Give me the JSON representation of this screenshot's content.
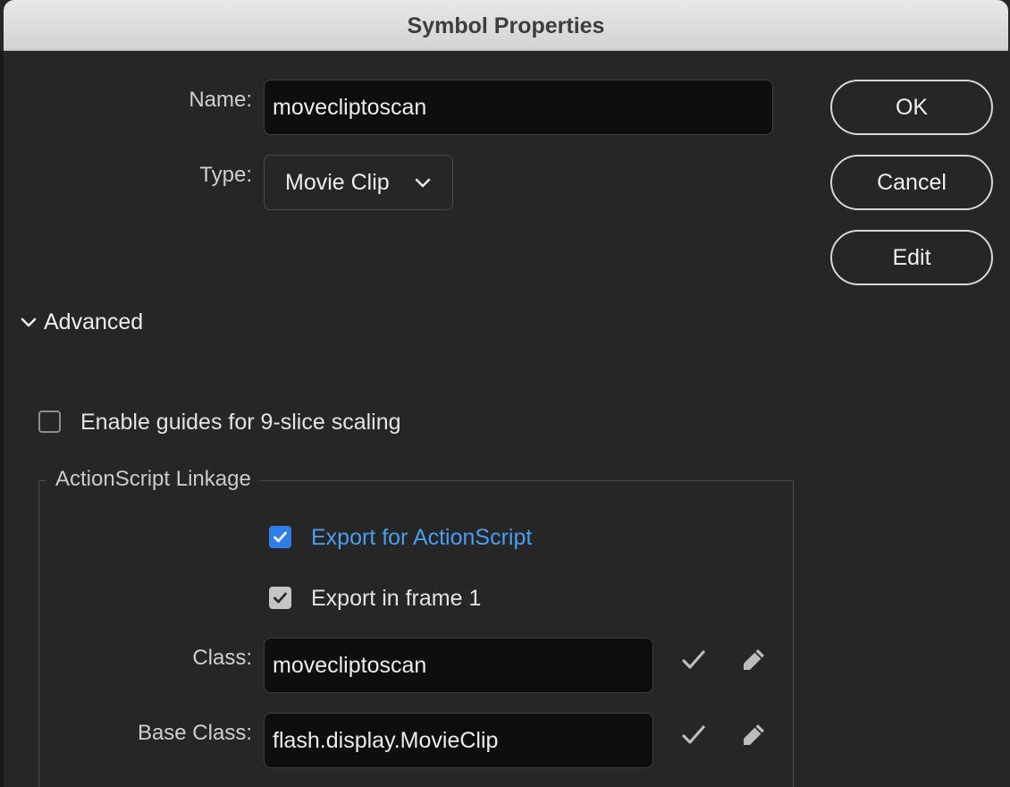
{
  "window": {
    "title": "Symbol Properties"
  },
  "form": {
    "name_label": "Name:",
    "name_value": "movecliptoscan",
    "type_label": "Type:",
    "type_value": "Movie Clip"
  },
  "buttons": {
    "ok": "OK",
    "cancel": "Cancel",
    "edit": "Edit"
  },
  "advanced": {
    "label": "Advanced",
    "expanded": true,
    "nine_slice": {
      "label": "Enable guides for 9-slice scaling",
      "checked": false
    }
  },
  "linkage": {
    "group_title": "ActionScript Linkage",
    "export_actionscript": {
      "label": "Export for ActionScript",
      "checked": true
    },
    "export_frame1": {
      "label": "Export in frame 1",
      "checked": true
    },
    "class_label": "Class:",
    "class_value": "movecliptoscan",
    "base_class_label": "Base Class:",
    "base_class_value": "flash.display.MovieClip"
  },
  "icons": {
    "dropdown": "chevron-down-icon",
    "disclosure": "chevron-down-icon",
    "validate": "checkmark-icon",
    "edit": "pencil-icon"
  },
  "colors": {
    "accent": "#2f7ee8",
    "accent_text": "#4a9df0",
    "background": "#262626",
    "field_bg": "#0e0e0e"
  }
}
